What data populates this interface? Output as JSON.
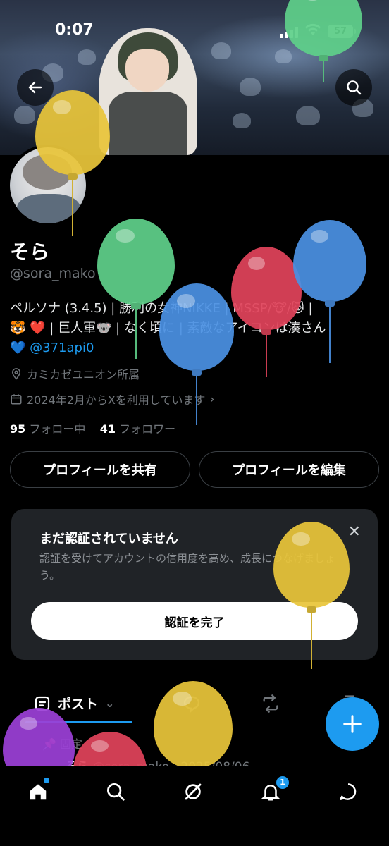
{
  "status_bar": {
    "time": "0:07",
    "battery": "57"
  },
  "profile": {
    "name": "そら",
    "handle": "@sora_mako",
    "bio_lines": [
      "ペルソナ (3.4.5) | 勝利の女神NIKKE | MSSP/🐮/🐱 |",
      "🐯 ❤️ | 巨人軍🐨 | なく頃に | 素敵なアイコンは湊さん"
    ],
    "bio_heart": "💙",
    "bio_mention": "@371api0",
    "affiliation": "カミカゼユニオン所属",
    "joined": "2024年2月からXを利用しています",
    "following_count": "95",
    "following_label": "フォロー中",
    "followers_count": "41",
    "followers_label": "フォロワー"
  },
  "actions": {
    "share_label": "プロフィールを共有",
    "edit_label": "プロフィールを編集"
  },
  "verify_card": {
    "title": "まだ認証されていません",
    "desc": "認証を受けてアカウントの信用度を高め、成長につなげましょう。",
    "cta": "認証を完了"
  },
  "tabs": {
    "posts_label": "ポスト"
  },
  "post_preview": {
    "pinned": "固定",
    "author": "そら",
    "meta": "@sora_mako · 2025/08/06"
  },
  "nav": {
    "notifications_badge": "1"
  },
  "colors": {
    "accent": "#1d9bf0",
    "background": "#000000",
    "card": "#202327"
  },
  "balloons": [
    {
      "color": "#e8c53a"
    },
    {
      "color": "#5fd08a"
    },
    {
      "color": "#5fd08a"
    },
    {
      "color": "#4a90e2"
    },
    {
      "color": "#e0435a"
    },
    {
      "color": "#4a90e2"
    },
    {
      "color": "#e8c53a"
    },
    {
      "color": "#e8c53a"
    },
    {
      "color": "#9b3fd6"
    },
    {
      "color": "#e0435a"
    }
  ]
}
